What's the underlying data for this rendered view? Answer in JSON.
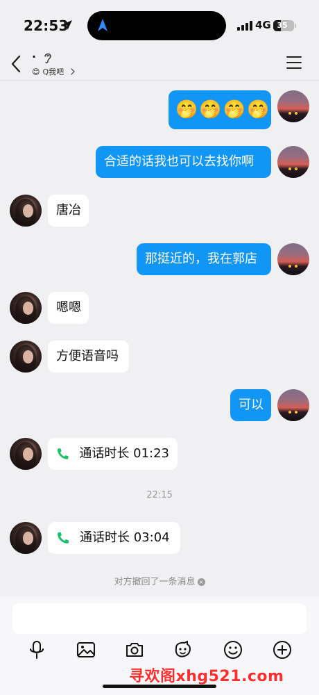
{
  "status_bar": {
    "time": "22:53",
    "network": "4G",
    "battery": "35",
    "battery_level": 0.35
  },
  "nav": {
    "contact_name": "·",
    "subtitle_emoji": "😊",
    "subtitle": "Q我吧",
    "back_icon": "chevron-left-icon",
    "menu_icon": "hamburger-menu-icon"
  },
  "messages": [
    {
      "side": "me",
      "type": "emoji",
      "text": "🤭🤭🤭🤭"
    },
    {
      "side": "me",
      "type": "text",
      "text": "合适的话我也可以去找你啊"
    },
    {
      "side": "other",
      "type": "text",
      "text": "唐冶"
    },
    {
      "side": "me",
      "type": "text",
      "text": "那挺近的，我在郭店"
    },
    {
      "side": "other",
      "type": "text",
      "text": "嗯嗯"
    },
    {
      "side": "other",
      "type": "text",
      "text": "方便语音吗"
    },
    {
      "side": "me",
      "type": "text",
      "text": "可以"
    },
    {
      "side": "other",
      "type": "call",
      "text": "通话时长 01:23"
    },
    {
      "side": "other",
      "type": "call",
      "text": "通话时长 03:04"
    }
  ],
  "time_divider": "22:15",
  "system_note": "对方撤回了一条消息",
  "system_note_icon": "×",
  "composer": {
    "tools": [
      "microphone-icon",
      "image-icon",
      "camera-icon",
      "sticker-icon",
      "emoji-icon",
      "plus-icon"
    ]
  },
  "watermark": "寻欢阁xhg521.com",
  "colors": {
    "bubble_me": "#1296f5",
    "bubble_other": "#ffffff",
    "background": "#f0f0f2",
    "call_green": "#19c26b",
    "watermark": "#ff2d2d"
  }
}
